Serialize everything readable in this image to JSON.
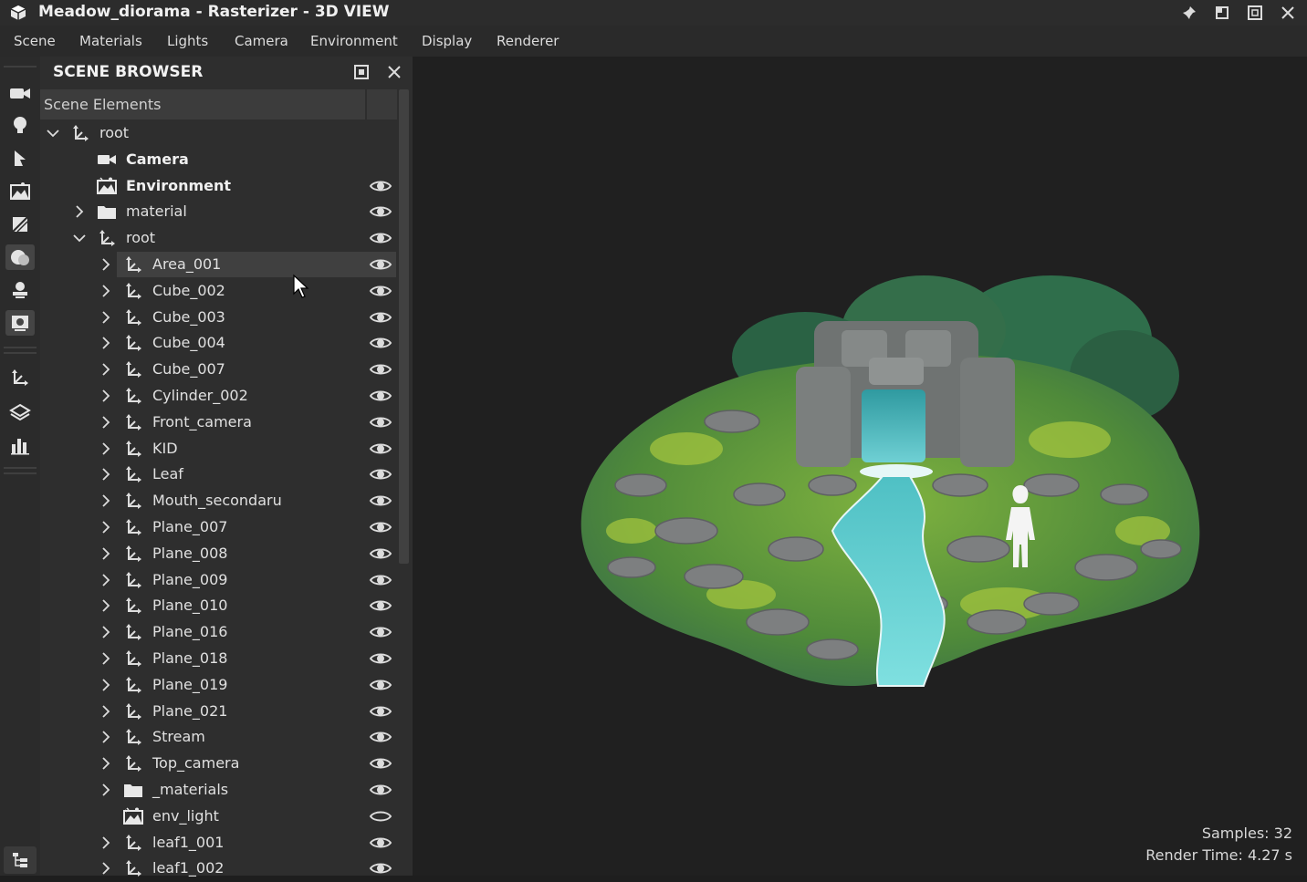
{
  "window": {
    "title": "Meadow_diorama - Rasterizer - 3D VIEW"
  },
  "menu": [
    "Scene",
    "Materials",
    "Lights",
    "Camera",
    "Environment",
    "Display",
    "Renderer"
  ],
  "toolbar": {
    "tools": [
      "camera-icon",
      "light-bulb-icon",
      "pointer-icon",
      "environment-icon",
      "texture-icon",
      "material-sphere-icon",
      "stamp-icon",
      "render-settings-icon",
      "transform-icon",
      "layers-icon",
      "stats-chart-icon"
    ],
    "active": "material-sphere-icon",
    "bottom": "scene-tree-icon"
  },
  "panel": {
    "title": "SCENE BROWSER",
    "column_header": "Scene Elements",
    "rows": [
      {
        "label": "root",
        "indent": 0,
        "icon": "transform-icon",
        "expand": "open",
        "bold": false,
        "eye": "none",
        "selected": false
      },
      {
        "label": "Camera",
        "indent": 1,
        "icon": "camera-icon",
        "expand": "none",
        "bold": true,
        "eye": "none",
        "selected": false
      },
      {
        "label": "Environment",
        "indent": 1,
        "icon": "environment-icon",
        "expand": "none",
        "bold": true,
        "eye": "visible",
        "selected": false
      },
      {
        "label": "material",
        "indent": 1,
        "icon": "folder-icon",
        "expand": "closed",
        "bold": false,
        "eye": "visible",
        "selected": false
      },
      {
        "label": "root",
        "indent": 1,
        "icon": "transform-icon",
        "expand": "open",
        "bold": false,
        "eye": "visible",
        "selected": false
      },
      {
        "label": "Area_001",
        "indent": 2,
        "icon": "transform-icon",
        "expand": "closed",
        "bold": false,
        "eye": "visible",
        "selected": true
      },
      {
        "label": "Cube_002",
        "indent": 2,
        "icon": "transform-icon",
        "expand": "closed",
        "bold": false,
        "eye": "visible",
        "selected": false
      },
      {
        "label": "Cube_003",
        "indent": 2,
        "icon": "transform-icon",
        "expand": "closed",
        "bold": false,
        "eye": "visible",
        "selected": false
      },
      {
        "label": "Cube_004",
        "indent": 2,
        "icon": "transform-icon",
        "expand": "closed",
        "bold": false,
        "eye": "visible",
        "selected": false
      },
      {
        "label": "Cube_007",
        "indent": 2,
        "icon": "transform-icon",
        "expand": "closed",
        "bold": false,
        "eye": "visible",
        "selected": false
      },
      {
        "label": "Cylinder_002",
        "indent": 2,
        "icon": "transform-icon",
        "expand": "closed",
        "bold": false,
        "eye": "visible",
        "selected": false
      },
      {
        "label": "Front_camera",
        "indent": 2,
        "icon": "transform-icon",
        "expand": "closed",
        "bold": false,
        "eye": "visible",
        "selected": false
      },
      {
        "label": "KID",
        "indent": 2,
        "icon": "transform-icon",
        "expand": "closed",
        "bold": false,
        "eye": "visible",
        "selected": false
      },
      {
        "label": "Leaf",
        "indent": 2,
        "icon": "transform-icon",
        "expand": "closed",
        "bold": false,
        "eye": "visible",
        "selected": false
      },
      {
        "label": "Mouth_secondaru",
        "indent": 2,
        "icon": "transform-icon",
        "expand": "closed",
        "bold": false,
        "eye": "visible",
        "selected": false
      },
      {
        "label": "Plane_007",
        "indent": 2,
        "icon": "transform-icon",
        "expand": "closed",
        "bold": false,
        "eye": "visible",
        "selected": false
      },
      {
        "label": "Plane_008",
        "indent": 2,
        "icon": "transform-icon",
        "expand": "closed",
        "bold": false,
        "eye": "visible",
        "selected": false
      },
      {
        "label": "Plane_009",
        "indent": 2,
        "icon": "transform-icon",
        "expand": "closed",
        "bold": false,
        "eye": "visible",
        "selected": false
      },
      {
        "label": "Plane_010",
        "indent": 2,
        "icon": "transform-icon",
        "expand": "closed",
        "bold": false,
        "eye": "visible",
        "selected": false
      },
      {
        "label": "Plane_016",
        "indent": 2,
        "icon": "transform-icon",
        "expand": "closed",
        "bold": false,
        "eye": "visible",
        "selected": false
      },
      {
        "label": "Plane_018",
        "indent": 2,
        "icon": "transform-icon",
        "expand": "closed",
        "bold": false,
        "eye": "visible",
        "selected": false
      },
      {
        "label": "Plane_019",
        "indent": 2,
        "icon": "transform-icon",
        "expand": "closed",
        "bold": false,
        "eye": "visible",
        "selected": false
      },
      {
        "label": "Plane_021",
        "indent": 2,
        "icon": "transform-icon",
        "expand": "closed",
        "bold": false,
        "eye": "visible",
        "selected": false
      },
      {
        "label": "Stream",
        "indent": 2,
        "icon": "transform-icon",
        "expand": "closed",
        "bold": false,
        "eye": "visible",
        "selected": false
      },
      {
        "label": "Top_camera",
        "indent": 2,
        "icon": "transform-icon",
        "expand": "closed",
        "bold": false,
        "eye": "visible",
        "selected": false
      },
      {
        "label": "_materials",
        "indent": 2,
        "icon": "folder-icon",
        "expand": "closed",
        "bold": false,
        "eye": "visible",
        "selected": false
      },
      {
        "label": "env_light",
        "indent": 2,
        "icon": "environment-icon",
        "expand": "none",
        "bold": false,
        "eye": "hidden",
        "selected": false
      },
      {
        "label": "leaf1_001",
        "indent": 2,
        "icon": "transform-icon",
        "expand": "closed",
        "bold": false,
        "eye": "visible",
        "selected": false
      },
      {
        "label": "leaf1_002",
        "indent": 2,
        "icon": "transform-icon",
        "expand": "closed",
        "bold": false,
        "eye": "visible",
        "selected": false
      }
    ]
  },
  "viewport": {
    "samples": "Samples: 32",
    "render_time": "Render Time: 4.27 s",
    "scene_colors": {
      "grass": "#5f9a3a",
      "moss": "#9cbf3a",
      "rock": "#7d7f80",
      "water": "#59c2c8",
      "tree": "#2f6e4b"
    }
  }
}
